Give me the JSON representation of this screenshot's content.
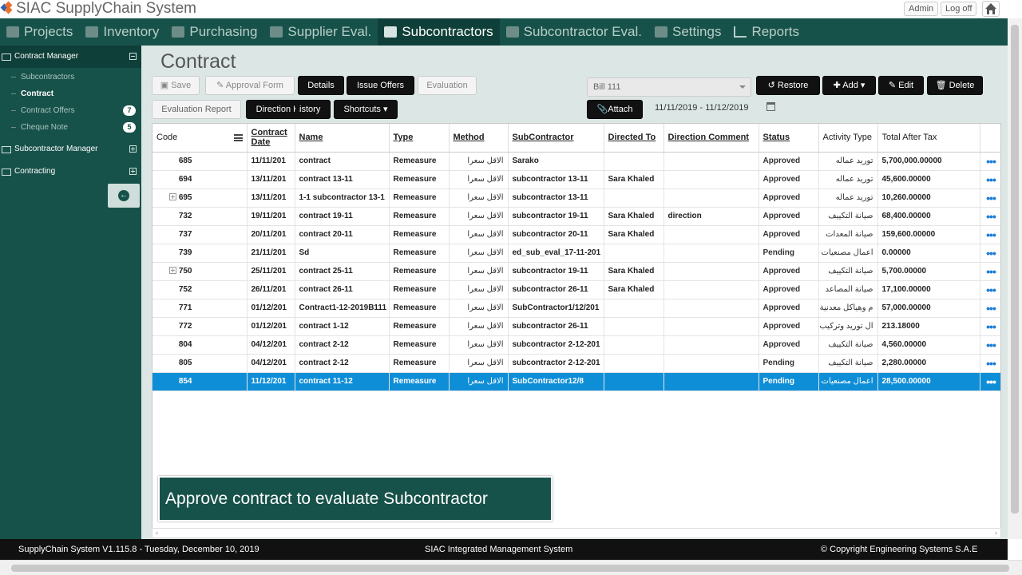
{
  "app": {
    "title": "SIAC SupplyChain System",
    "admin_label": "Admin",
    "logoff_label": "Log off"
  },
  "nav": {
    "items": [
      {
        "label": "Projects",
        "icon": "tag-icon"
      },
      {
        "label": "Inventory",
        "icon": "box-icon"
      },
      {
        "label": "Purchasing",
        "icon": "box-icon"
      },
      {
        "label": "Supplier Eval.",
        "icon": "box-icon"
      },
      {
        "label": "Subcontractors",
        "icon": "grid-icon",
        "active": true
      },
      {
        "label": "Subcontractor Eval.",
        "icon": "grid-icon"
      },
      {
        "label": "Settings",
        "icon": "box-icon"
      },
      {
        "label": "Reports",
        "icon": "chart-icon"
      }
    ]
  },
  "sidebar": {
    "contract_manager": "Contract Manager",
    "items": [
      {
        "label": "Subcontractors"
      },
      {
        "label": "Contract",
        "active": true
      },
      {
        "label": "Contract Offers",
        "badge": "7"
      },
      {
        "label": "Cheque Note",
        "badge": "5"
      }
    ],
    "subcontractor_manager": "Subcontractor Manager",
    "contracting": "Contracting"
  },
  "page": {
    "title": "Contract"
  },
  "toolbar": {
    "save": "Save",
    "approval_form": "Approval Form",
    "details": "Details",
    "issue_offers": "Issue Offers",
    "evaluation": "Evaluation",
    "evaluation_report": "Evaluation Report",
    "direction_history": "Direction History",
    "shortcuts": "Shortcuts",
    "bill_value": "Bill 111",
    "restore": "Restore",
    "add": "Add",
    "edit": "Edit",
    "delete": "Delete",
    "attach": "Attach",
    "date_range": "11/11/2019 - 11/12/2019"
  },
  "table": {
    "headers": {
      "code": "Code",
      "contract_date": "Contract Date",
      "name": "Name",
      "type": "Type",
      "method": "Method",
      "subcontractor": "SubContractor",
      "directed_to": "Directed To",
      "direction_comment": "Direction Comment",
      "status": "Status",
      "activity_type": "Activity Type",
      "total_after_tax": "Total After Tax"
    },
    "rows": [
      {
        "code": "685",
        "date": "11/11/201",
        "name": "contract",
        "type": "Remeasure",
        "method": "الاقل سعرا",
        "sub": "Sarako",
        "directed": "",
        "comment": "",
        "status": "Approved",
        "activity": "توريد عماله",
        "total": "5,700,000.00000"
      },
      {
        "code": "694",
        "date": "13/11/201",
        "name": "contract 13-11",
        "type": "Remeasure",
        "method": "الاقل سعرا",
        "sub": "subcontractor 13-11",
        "directed": "Sara Khaled",
        "comment": "",
        "status": "Approved",
        "activity": "توريد عماله",
        "total": "45,600.00000"
      },
      {
        "code": "695",
        "date": "13/11/201",
        "name": "1-1 subcontractor 13-1",
        "type": "Remeasure",
        "method": "الاقل سعرا",
        "sub": "subcontractor 13-11",
        "directed": "",
        "comment": "",
        "status": "Approved",
        "activity": "توريد عماله",
        "total": "10,260.00000",
        "expandable": true
      },
      {
        "code": "732",
        "date": "19/11/201",
        "name": "contract 19-11",
        "type": "Remeasure",
        "method": "الاقل سعرا",
        "sub": "subcontractor 19-11",
        "directed": "Sara Khaled",
        "comment": "direction",
        "status": "Approved",
        "activity": "صيانة التكييف",
        "total": "68,400.00000"
      },
      {
        "code": "737",
        "date": "20/11/201",
        "name": "contract 20-11",
        "type": "Remeasure",
        "method": "الاقل سعرا",
        "sub": "subcontractor 20-11",
        "directed": "Sara Khaled",
        "comment": "",
        "status": "Approved",
        "activity": "صيانة المعدات",
        "total": "159,600.00000"
      },
      {
        "code": "739",
        "date": "21/11/201",
        "name": "Sd",
        "type": "Remeasure",
        "method": "الاقل سعرا",
        "sub": "ed_sub_eval_17-11-201",
        "directed": "",
        "comment": "",
        "status": "Pending",
        "activity": "اعمال مصنعيات",
        "total": "0.00000"
      },
      {
        "code": "750",
        "date": "25/11/201",
        "name": "contract 25-11",
        "type": "Remeasure",
        "method": "الاقل سعرا",
        "sub": "subcontractor 19-11",
        "directed": "Sara Khaled",
        "comment": "",
        "status": "Approved",
        "activity": "صيانة التكييف",
        "total": "5,700.00000",
        "expandable": true
      },
      {
        "code": "752",
        "date": "26/11/201",
        "name": "contract 26-11",
        "type": "Remeasure",
        "method": "الاقل سعرا",
        "sub": "subcontractor 26-11",
        "directed": "Sara Khaled",
        "comment": "",
        "status": "Approved",
        "activity": "صيانة المصاعد",
        "total": "17,100.00000"
      },
      {
        "code": "771",
        "date": "01/12/201",
        "name": "Contract1-12-2019B111",
        "type": "Remeasure",
        "method": "الاقل سعرا",
        "sub": "SubContractor1/12/201",
        "directed": "",
        "comment": "",
        "status": "Approved",
        "activity": "م وهياكل معدنية",
        "total": "57,000.00000"
      },
      {
        "code": "772",
        "date": "01/12/201",
        "name": "contract 1-12",
        "type": "Remeasure",
        "method": "الاقل سعرا",
        "sub": "subcontractor 26-11",
        "directed": "",
        "comment": "",
        "status": "Approved",
        "activity": "ال توريد وتركيب",
        "total": "213.18000"
      },
      {
        "code": "804",
        "date": "04/12/201",
        "name": "contract 2-12",
        "type": "Remeasure",
        "method": "الاقل سعرا",
        "sub": "subcontractor 2-12-201",
        "directed": "",
        "comment": "",
        "status": "Approved",
        "activity": "صيانة التكييف",
        "total": "4,560.00000"
      },
      {
        "code": "805",
        "date": "04/12/201",
        "name": "contract 2-12",
        "type": "Remeasure",
        "method": "الاقل سعرا",
        "sub": "subcontractor 2-12-201",
        "directed": "",
        "comment": "",
        "status": "Pending",
        "activity": "صيانة التكييف",
        "total": "2,280.00000"
      },
      {
        "code": "854",
        "date": "11/12/201",
        "name": "contract 11-12",
        "type": "Remeasure",
        "method": "الاقل سعرا",
        "sub": "SubContractor12/8",
        "directed": "",
        "comment": "",
        "status": "Pending",
        "activity": "اعمال مصنعيات",
        "total": "28,500.00000",
        "selected": true
      }
    ],
    "more_glyph": "•••"
  },
  "caption": "Approve contract to evaluate Subcontractor",
  "footer": {
    "version": "SupplyChain System V1.115.8 - Tuesday, December 10, 2019",
    "center": "SIAC Integrated Management System",
    "copyright": "© Copyright Engineering Systems S.A.E"
  },
  "colors": {
    "brand": "#17524a",
    "brand_dark": "#0f3f39",
    "selection": "#0f8ed8"
  }
}
